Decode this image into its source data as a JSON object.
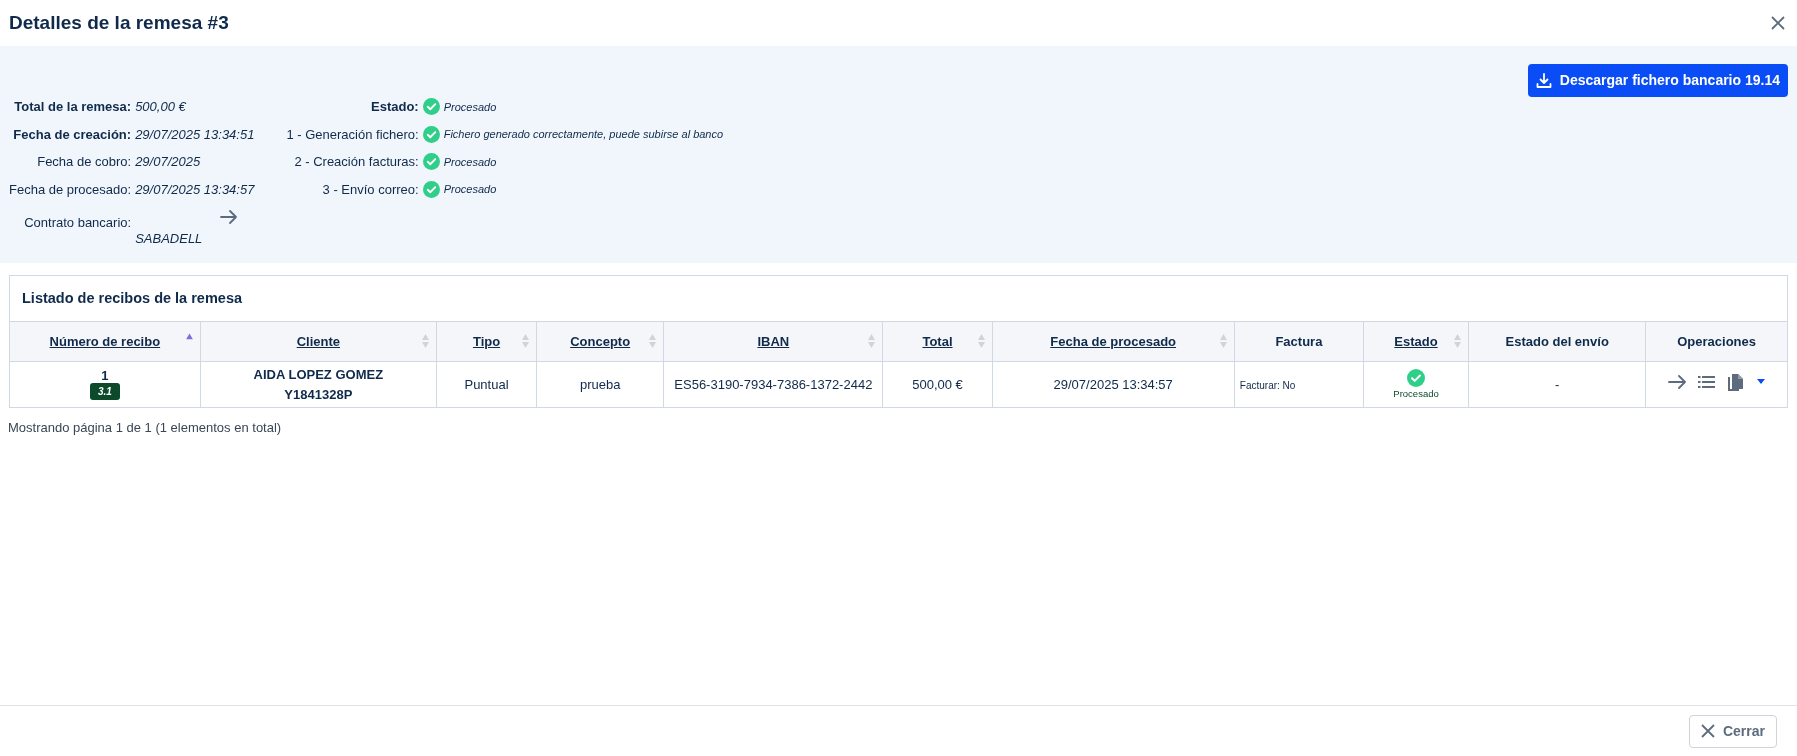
{
  "dialog": {
    "title": "Detalles de la remesa #3"
  },
  "download_button": {
    "label": "Descargar fichero bancario 19.14"
  },
  "summary_left": [
    {
      "label": "Total de la remesa:",
      "value": "500,00 €",
      "bold": true
    },
    {
      "label": "Fecha de creación:",
      "value": "29/07/2025 13:34:51",
      "bold": true
    },
    {
      "label": "Fecha de cobro:",
      "value": "29/07/2025",
      "bold": false
    },
    {
      "label": "Fecha de procesado:",
      "value": "29/07/2025 13:34:57",
      "bold": false
    }
  ],
  "contract": {
    "label": "Contrato bancario:",
    "value": "SABADELL"
  },
  "summary_right": [
    {
      "label": "Estado:",
      "value": "Procesado",
      "bold": true,
      "done": true
    },
    {
      "label": "1 - Generación fichero:",
      "value": "Fichero generado correctamente, puede subirse al banco",
      "bold": false,
      "done": true
    },
    {
      "label": "2 - Creación facturas:",
      "value": "Procesado",
      "bold": false,
      "done": true
    },
    {
      "label": "3 - Envío correo:",
      "value": "Procesado",
      "bold": false,
      "done": true
    }
  ],
  "table": {
    "title": "Listado de recibos de la remesa",
    "columns": [
      {
        "label": "Número de recibo",
        "sortable": true,
        "sorted": true
      },
      {
        "label": "Cliente",
        "sortable": true,
        "sorted": false
      },
      {
        "label": "Tipo",
        "sortable": true,
        "sorted": false
      },
      {
        "label": "Concepto",
        "sortable": true,
        "sorted": false
      },
      {
        "label": "IBAN",
        "sortable": true,
        "sorted": false
      },
      {
        "label": "Total",
        "sortable": true,
        "sorted": false
      },
      {
        "label": "Fecha de procesado",
        "sortable": true,
        "sorted": false
      },
      {
        "label": "Factura",
        "sortable": false
      },
      {
        "label": "Estado",
        "sortable": true,
        "sorted": false
      },
      {
        "label": "Estado del envío",
        "sortable": false
      },
      {
        "label": "Operaciones",
        "sortable": false
      }
    ],
    "rows": [
      {
        "receipt_number": "1",
        "receipt_badge": "3.1",
        "client_name": "AIDA LOPEZ GOMEZ",
        "client_id": "Y1841328P",
        "tipo": "Puntual",
        "concepto": "prueba",
        "iban": "ES56-3190-7934-7386-1372-2442",
        "total": "500,00 €",
        "fecha": "29/07/2025 13:34:57",
        "factura": "Facturar: No",
        "estado": {
          "done": true,
          "label": "Procesado"
        },
        "envio": "-"
      }
    ]
  },
  "pagination": "Mostrando página 1 de 1 (1 elementos en total)",
  "close_button": {
    "label": "Cerrar"
  }
}
